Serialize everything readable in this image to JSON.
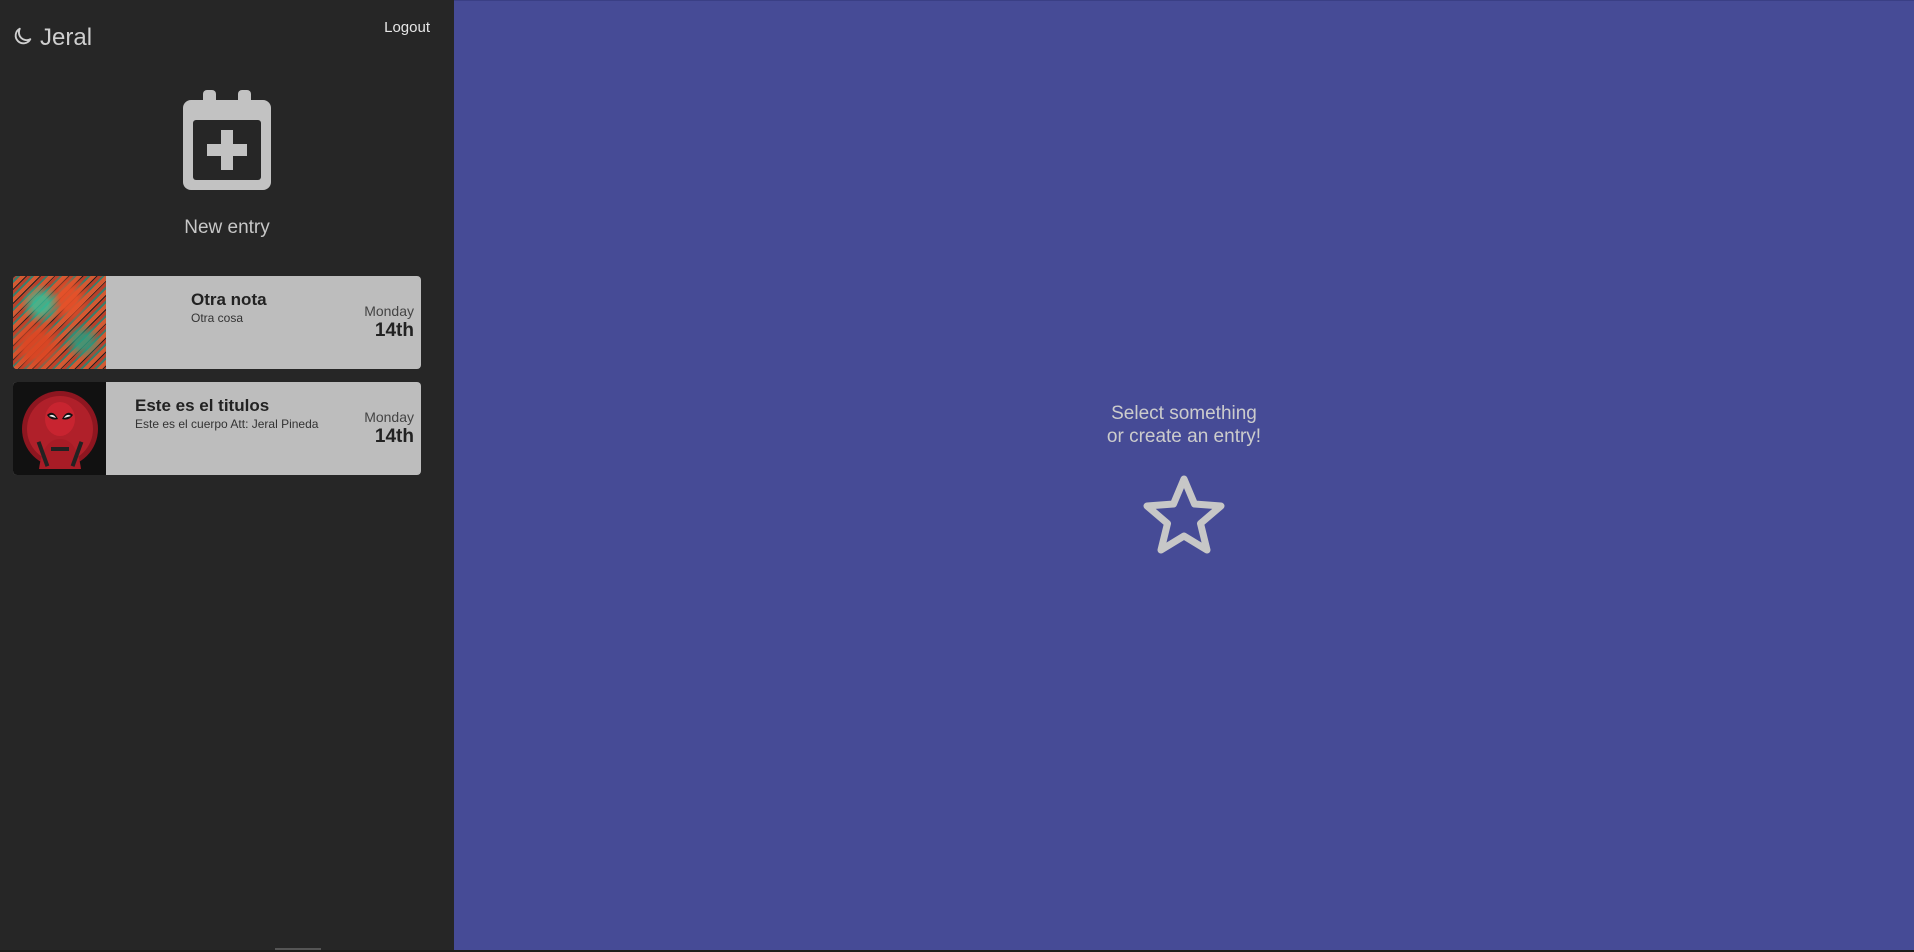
{
  "sidebar": {
    "brand": {
      "icon": "moon-icon",
      "name": "Jeral"
    },
    "logout_label": "Logout",
    "new_entry": {
      "icon": "calendar-plus-icon",
      "label": "New entry"
    },
    "entries": [
      {
        "title": "Otra nota",
        "body": "Otra cosa",
        "day": "Monday",
        "date": "14th",
        "thumbnail": "feather-image"
      },
      {
        "title": "Este es el titulos",
        "body": "Este es el cuerpo Att: Jeral Pineda",
        "day": "Monday",
        "date": "14th",
        "thumbnail": "deadpool-image"
      }
    ]
  },
  "main": {
    "empty_line1": "Select something",
    "empty_line2": "or create an entry!",
    "icon": "star-icon"
  },
  "colors": {
    "sidebar_bg": "#262626",
    "main_bg": "#464b96",
    "entry_bg": "#bdbdbd"
  }
}
